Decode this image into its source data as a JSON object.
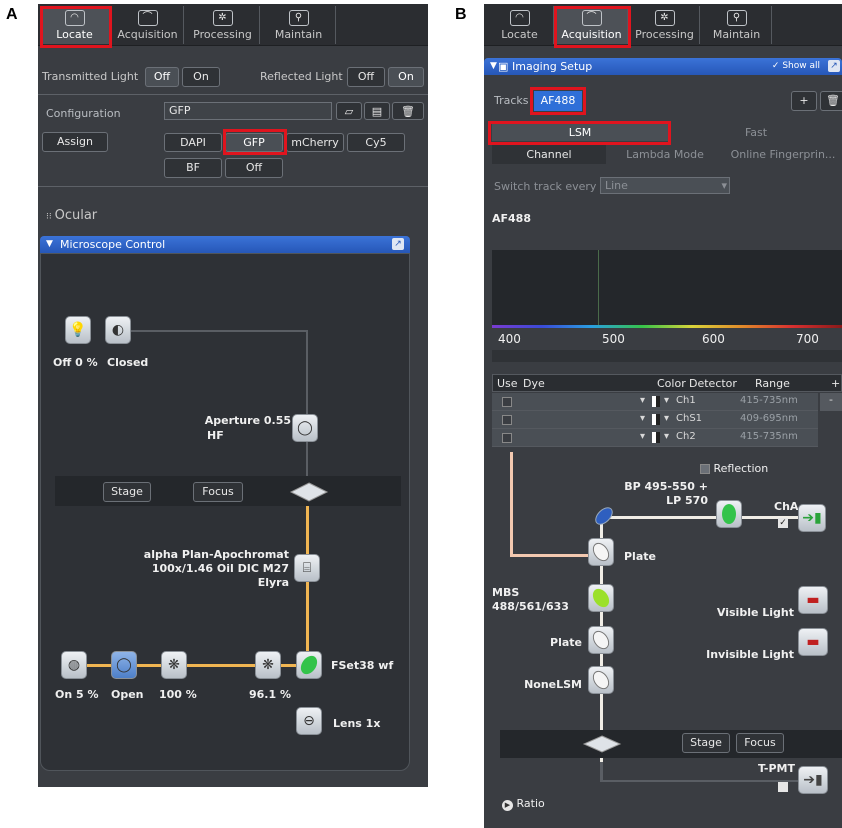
{
  "panels": {
    "a": "A",
    "b": "B"
  },
  "tabs": [
    {
      "label": "Locate",
      "icon": "locate-icon"
    },
    {
      "label": "Acquisition",
      "icon": "acquisition-icon"
    },
    {
      "label": "Processing",
      "icon": "processing-icon"
    },
    {
      "label": "Maintain",
      "icon": "maintain-icon"
    }
  ],
  "left": {
    "transmitted": "Transmitted Light",
    "reflected": "Reflected Light",
    "off": "Off",
    "on": "On",
    "config_label": "Configuration",
    "config_value": "GFP",
    "assign": "Assign",
    "filters": [
      "DAPI",
      "GFP",
      "mCherry",
      "Cy5"
    ],
    "filters2": [
      "BF",
      "Off"
    ],
    "ocular": "Ocular",
    "mc_title": "Microscope Control",
    "lamp_status": "Off 0 %",
    "closed": "Closed",
    "aperture": "Aperture 0.55",
    "aperture_hf": "HF",
    "stage": "Stage",
    "focus": "Focus",
    "objective1": "alpha Plan-Apochromat",
    "objective2": "100x/1.46 Oil DIC M27",
    "objective3": "Elyra",
    "bottom_labels": [
      "On 5 %",
      "Open",
      "100 %",
      "96.1 %"
    ],
    "fset": "FSet38 wf",
    "lens": "Lens 1x"
  },
  "right": {
    "imaging_setup": "Imaging Setup",
    "show_all": "✓ Show all",
    "tracks": "Tracks",
    "track_name": "AF488",
    "lsm": "LSM",
    "fast": "Fast",
    "modes": [
      "Channel",
      "Lambda Mode",
      "Online Fingerprin..."
    ],
    "switch_label": "Switch track every",
    "switch_value": "Line",
    "track_title": "AF488",
    "ticks": [
      "400",
      "500",
      "600",
      "700"
    ],
    "table_headers": [
      "Use",
      "Dye",
      "Color",
      "Detector",
      "Range",
      "+"
    ],
    "rows": [
      {
        "det": "Ch1",
        "range": "415-735nm"
      },
      {
        "det": "ChS1",
        "range": "409-695nm"
      },
      {
        "det": "Ch2",
        "range": "415-735nm"
      }
    ],
    "reflection": "Reflection",
    "bp1": "BP 495-550 +",
    "bp2": "LP 570",
    "cha": "ChA",
    "plate": "Plate",
    "mbs1": "MBS",
    "mbs2": "488/561/633",
    "plate2": "Plate",
    "visible": "Visible Light",
    "invisible": "Invisible Light",
    "nonelsm": "NoneLSM",
    "stage": "Stage",
    "focus": "Focus",
    "tpmt": "T-PMT",
    "ratio": "Ratio"
  },
  "colors": {
    "red_highlight": "#e0141e",
    "beam": "#f0b552",
    "title_blue": "#2f63c8"
  }
}
